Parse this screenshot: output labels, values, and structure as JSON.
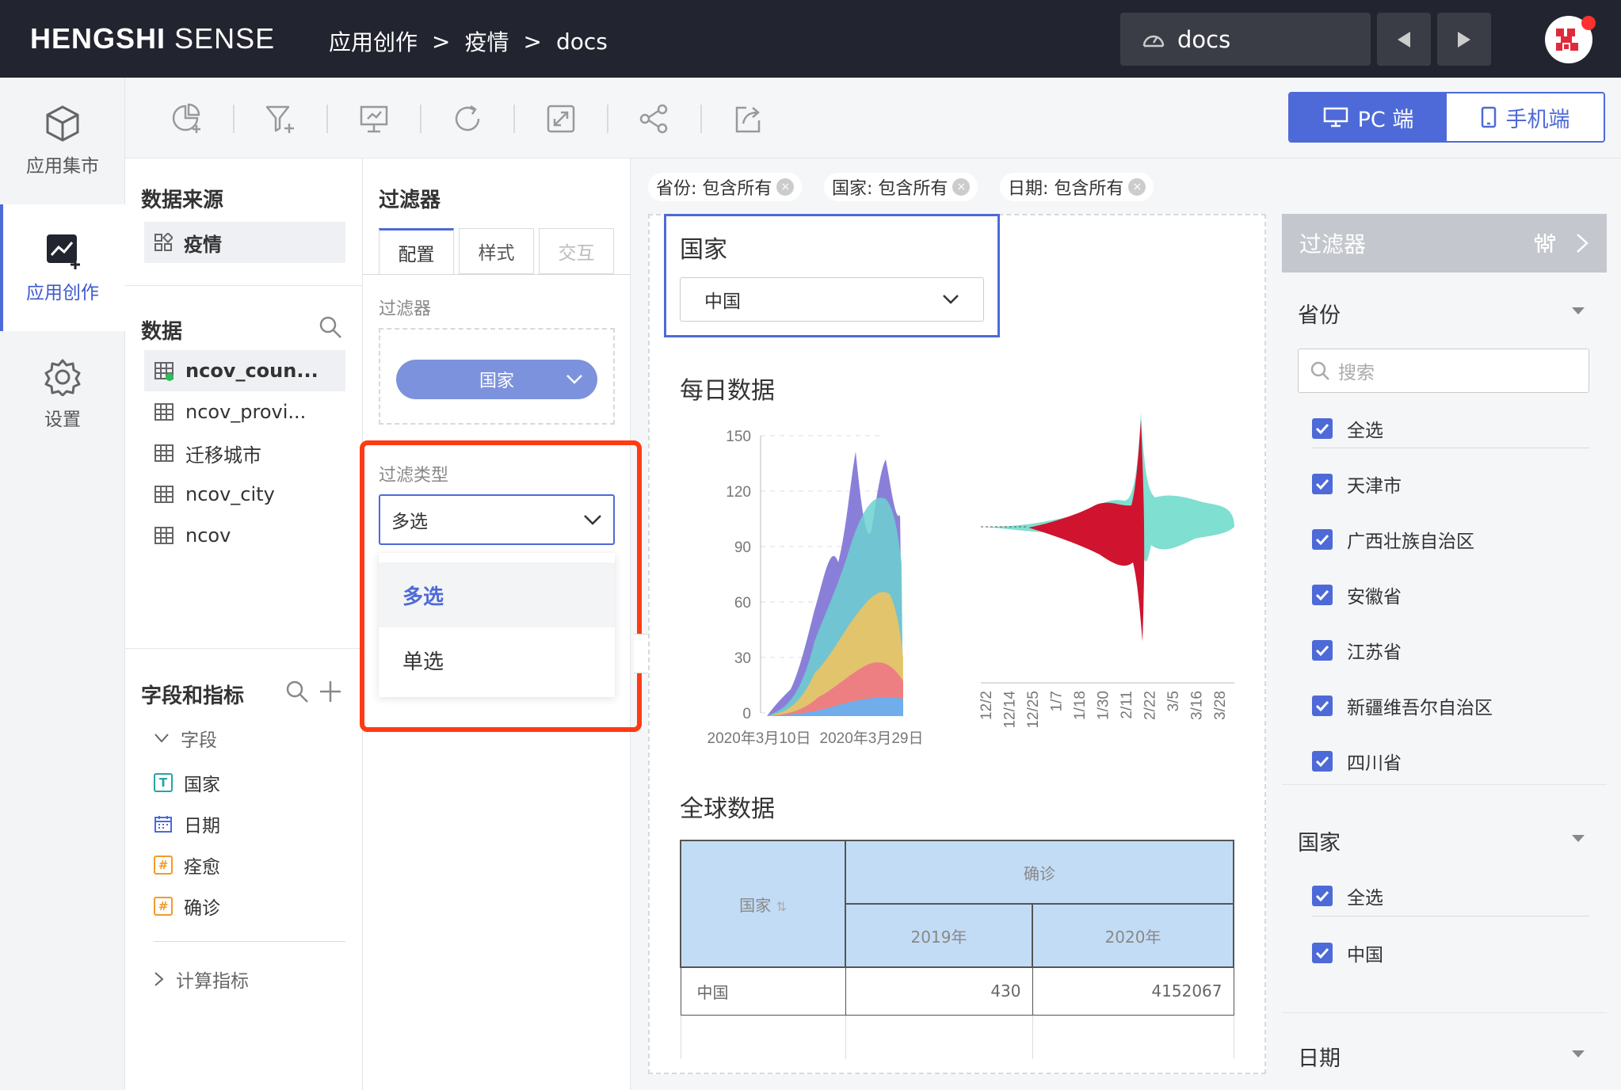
{
  "header": {
    "brand_bold": "HENGSHI",
    "brand_light": "SENSE",
    "breadcrumb": [
      "应用创作",
      ">",
      "疫情",
      ">",
      "docs"
    ],
    "dashboard_name": "docs"
  },
  "leftnav": [
    {
      "label": "应用集市",
      "icon": "cube-icon"
    },
    {
      "label": "应用创作",
      "icon": "chart-create-icon"
    },
    {
      "label": "设置",
      "icon": "gear-icon"
    }
  ],
  "toolbar": {
    "icons": [
      "add-chart-icon",
      "add-filter-icon",
      "presentation-icon",
      "refresh-icon",
      "expand-icon",
      "share-icon",
      "export-icon"
    ],
    "device_pc": "PC 端",
    "device_mobile": "手机端"
  },
  "datapanel": {
    "source_title": "数据来源",
    "source_item": "疫情",
    "data_title": "数据",
    "tables": [
      "ncov_coun...",
      "ncov_provi...",
      "迁移城市",
      "ncov_city",
      "ncov"
    ],
    "fields_title": "字段和指标",
    "fields_group": "字段",
    "fields": [
      {
        "tag": "T",
        "name": "国家",
        "color": "#2aa3a3"
      },
      {
        "tag": "cal",
        "name": "日期",
        "color": "#4e6ad8"
      },
      {
        "tag": "#",
        "name": "痊愈",
        "color": "#f39a2b"
      },
      {
        "tag": "#",
        "name": "确诊",
        "color": "#f39a2b"
      }
    ],
    "calc_group": "计算指标"
  },
  "config": {
    "title": "过滤器",
    "tabs": [
      "配置",
      "样式",
      "交互"
    ],
    "filter_label": "过滤器",
    "filter_field": "国家",
    "type_label": "过滤类型",
    "type_value": "多选",
    "options": [
      "多选",
      "单选"
    ]
  },
  "canvas": {
    "chips": [
      "省份: 包含所有",
      "国家: 包含所有",
      "日期: 包含所有"
    ],
    "control_title": "国家",
    "control_value": "中国",
    "chart1_title": "每日数据",
    "chart_data": {
      "type": "area",
      "ylim": [
        0,
        150
      ],
      "yticks": [
        0,
        30,
        60,
        90,
        120,
        150
      ],
      "xticks_left": [
        "2020年3月10日",
        "2020年3月29日"
      ],
      "xticks_right": [
        "12/2",
        "12/14",
        "12/25",
        "1/7",
        "1/18",
        "1/30",
        "2/11",
        "2/22",
        "3/5",
        "3/16",
        "3/28"
      ]
    },
    "table_title": "全球数据",
    "table": {
      "row_header": "国家",
      "group_header": "确诊",
      "cols": [
        "2019年",
        "2020年"
      ],
      "rows": [
        {
          "country": "中国",
          "v2019": "430",
          "v2020": "4152067"
        }
      ]
    }
  },
  "rpanel": {
    "title": "过滤器",
    "province_label": "省份",
    "search_placeholder": "搜索",
    "province_items": [
      "全选",
      "天津市",
      "广西壮族自治区",
      "安徽省",
      "江苏省",
      "新疆维吾尔自治区",
      "四川省"
    ],
    "country_label": "国家",
    "country_items": [
      "全选",
      "中国"
    ],
    "date_label": "日期"
  },
  "colors": {
    "accent": "#4e6ad8",
    "highlight": "#ff3b14",
    "header": "#22252f"
  }
}
